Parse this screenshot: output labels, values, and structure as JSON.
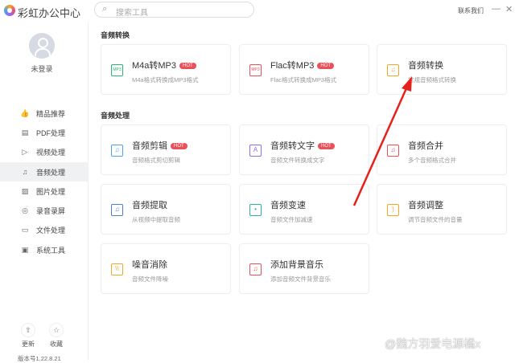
{
  "app": {
    "title": "彩虹办公中心",
    "contact": "联系我们",
    "minimize": "—",
    "close": "✕"
  },
  "search": {
    "placeholder": "搜索工具"
  },
  "user": {
    "status": "未登录"
  },
  "sidebar": {
    "items": [
      {
        "label": "精品推荐",
        "icon": "👍"
      },
      {
        "label": "PDF处理",
        "icon": "▤"
      },
      {
        "label": "视频处理",
        "icon": "▷"
      },
      {
        "label": "音频处理",
        "icon": "♫"
      },
      {
        "label": "图片处理",
        "icon": "▨"
      },
      {
        "label": "录音录屏",
        "icon": "◎"
      },
      {
        "label": "文件处理",
        "icon": "▭"
      },
      {
        "label": "系统工具",
        "icon": "▣"
      }
    ],
    "active": 3,
    "update": "更新",
    "favorite": "收藏",
    "version": "版本号1.22.8.21"
  },
  "sections": [
    {
      "title": "音频转换",
      "cards": [
        {
          "title": "M4a转MP3",
          "desc": "M4a格式转换成MP3格式",
          "hot": "HOT",
          "color": "#2bb673",
          "glyph": "MP3"
        },
        {
          "title": "Flac转MP3",
          "desc": "Flac格式转换成MP3格式",
          "hot": "HOT",
          "color": "#e9505a",
          "glyph": "MP3"
        },
        {
          "title": "音频转换",
          "desc": "常规音频格式转换",
          "color": "#f5a623",
          "glyph": "♫"
        }
      ]
    },
    {
      "title": "音频处理",
      "cards": [
        {
          "title": "音频剪辑",
          "desc": "音频格式剪切剪辑",
          "hot": "HOT",
          "color": "#4aa3f0",
          "glyph": "♫"
        },
        {
          "title": "音频转文字",
          "desc": "音频文件转换成文字",
          "hot": "HOT",
          "color": "#8e6cf0",
          "glyph": "A"
        },
        {
          "title": "音频合并",
          "desc": "多个音频格式合并",
          "color": "#e9505a",
          "glyph": "♫"
        },
        {
          "title": "音频提取",
          "desc": "从视频中提取音频",
          "color": "#4a7fd8",
          "glyph": "♫"
        },
        {
          "title": "音频变速",
          "desc": "音频文件加减速",
          "color": "#2bb69a",
          "glyph": "•"
        },
        {
          "title": "音频调整",
          "desc": "调节音频文件的音量",
          "color": "#f5a623",
          "glyph": ")"
        },
        {
          "title": "噪音消除",
          "desc": "音频文件降噪",
          "color": "#f5a623",
          "glyph": "\\\\"
        },
        {
          "title": "添加背景音乐",
          "desc": "添加音频文件背景音乐",
          "color": "#e9505a",
          "glyph": "♫"
        }
      ]
    }
  ],
  "watermark": "@魏方羽爱电源橘x"
}
